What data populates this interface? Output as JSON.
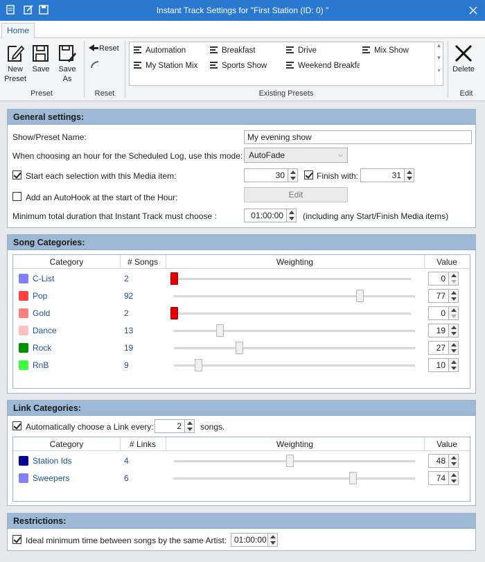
{
  "window": {
    "title": "Instant Track Settings for \"First Station (ID: 0) \""
  },
  "tabs": [
    {
      "label": "Home"
    }
  ],
  "ribbon": {
    "new_preset": "New Preset",
    "save": "Save",
    "save_as": "Save As",
    "group_preset": "Preset",
    "reset": "Reset",
    "group_reset": "Reset",
    "presets": [
      "Automation",
      "Breakfast",
      "Drive",
      "Mix Show",
      "My Station Mix",
      "Sports Show",
      "Weekend Breakfast"
    ],
    "group_presets": "Existing Presets",
    "delete": "Delete",
    "group_edit": "Edit"
  },
  "general": {
    "header": "General settings:",
    "name_label": "Show/Preset Name:",
    "name_value": "My evening show",
    "mode_label": "When choosing an hour for the Scheduled Log, use this mode:",
    "mode_value": "AutoFade",
    "start_label": "Start each selection with this Media item:",
    "start_checked": true,
    "start_value": "30",
    "finish_label": "Finish with:",
    "finish_checked": true,
    "finish_value": "31",
    "autohook_label": "Add an AutoHook at the start of the Hour:",
    "autohook_checked": false,
    "edit_label": "Edit",
    "min_label": "Minimum total duration that Instant Track must choose :",
    "min_value": "01:00:00",
    "min_note": "(including any Start/Finish Media items)"
  },
  "songs": {
    "header": "Song Categories:",
    "columns": {
      "category": "Category",
      "count": "# Songs",
      "weighting": "Weighting",
      "value": "Value"
    },
    "rows": [
      {
        "name": "C-List",
        "count": "2",
        "value": "0",
        "weight": 0,
        "color": "#8080ff"
      },
      {
        "name": "Pop",
        "count": "92",
        "value": "77",
        "weight": 77,
        "color": "#ff4040"
      },
      {
        "name": "Gold",
        "count": "2",
        "value": "0",
        "weight": 0,
        "color": "#ff8080"
      },
      {
        "name": "Dance",
        "count": "13",
        "value": "19",
        "weight": 19,
        "color": "#ffc0c0"
      },
      {
        "name": "Rock",
        "count": "19",
        "value": "27",
        "weight": 27,
        "color": "#009000"
      },
      {
        "name": "RnB",
        "count": "9",
        "value": "10",
        "weight": 10,
        "color": "#40ff40"
      }
    ]
  },
  "links": {
    "header": "Link Categories:",
    "auto_label": "Automatically choose a Link every:",
    "auto_checked": true,
    "auto_value": "2",
    "auto_suffix": "songs.",
    "columns": {
      "category": "Category",
      "count": "# Links",
      "weighting": "Weighting",
      "value": "Value"
    },
    "rows": [
      {
        "name": "Station Ids",
        "count": "4",
        "value": "48",
        "weight": 48,
        "color": "#000090"
      },
      {
        "name": "Sweepers",
        "count": "6",
        "value": "74",
        "weight": 74,
        "color": "#8080ff"
      }
    ]
  },
  "restrictions": {
    "header": "Restrictions:",
    "artist_label": "Ideal minimum time between songs by the same Artist:",
    "artist_checked": true,
    "artist_value": "01:00:00"
  }
}
